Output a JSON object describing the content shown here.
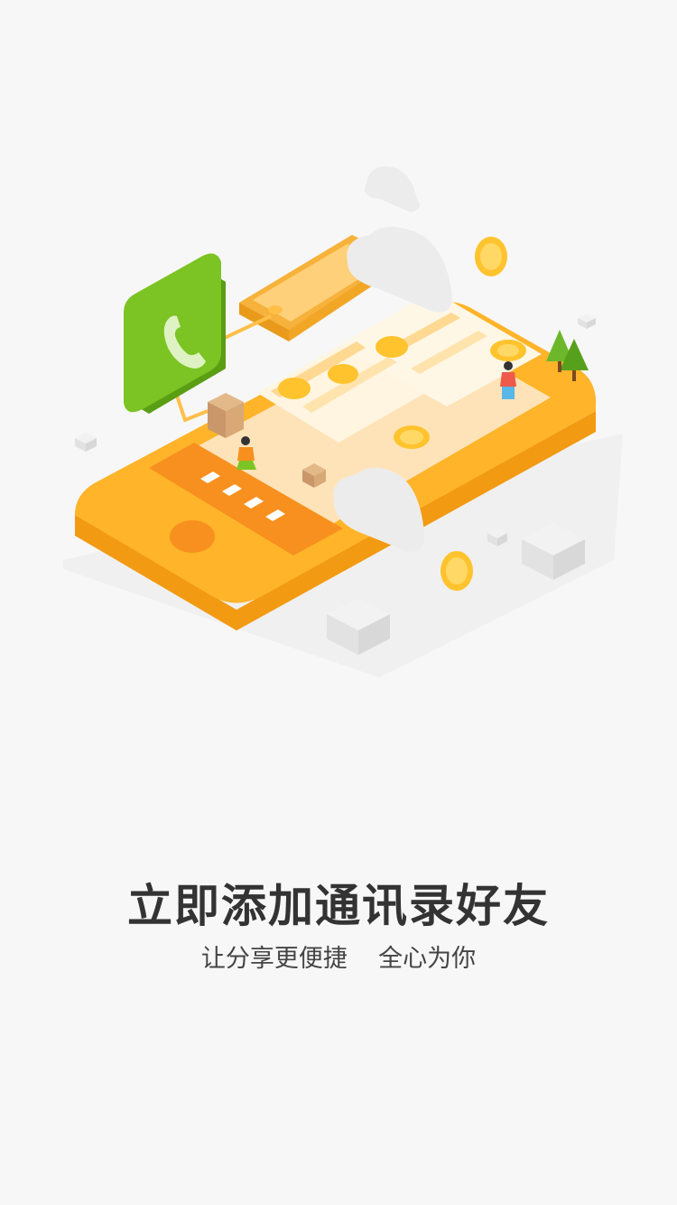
{
  "onboarding": {
    "title": "立即添加通讯录好友",
    "subtitle": "让分享更便捷    全心为你"
  },
  "colors": {
    "background": "#f7f7f7",
    "phone_body": "#ffb42a",
    "phone_edge": "#f29a12",
    "phone_keypad": "#f7901e",
    "call_icon_green": "#7cc423",
    "coin_gold": "#ffc32e",
    "cloud_white": "#ececec",
    "title_text": "#333333",
    "subtitle_text": "#444444"
  },
  "icons": {
    "call": "phone-call-icon",
    "coin": "heart-coin-icon",
    "cloud": "cloud-icon",
    "tree": "tree-icon"
  }
}
